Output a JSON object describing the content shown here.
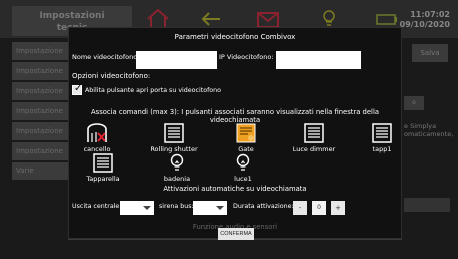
{
  "background": {
    "title_line1": "Impostazioni",
    "title_line2": "tecnic",
    "time": "11:07:02",
    "date": "09/10/2020",
    "save_label": "Salva",
    "sidebar": [
      "Impostazione",
      "Impostazione",
      "Impostazione",
      "Impostazione",
      "Impostazione",
      "Impostazione",
      "Varie"
    ],
    "side_text_1": "e Simplya",
    "side_text_2": "omaticamente,",
    "side_box": "o"
  },
  "dialog": {
    "title": "Parametri videocitofono Combivox",
    "name_label": "Nome videocitofono:",
    "name_value": "",
    "ip_label": "IP Videocitofono:",
    "ip_value": "",
    "options_label": "Opzioni videocitofono:",
    "door_checkbox_label": "Abilita pulsante apri porta su videocitofono",
    "door_checked": true,
    "associate_header": "Associa comandi (max 3): I pulsanti associati saranno visualizzati nella finestra della videochiamata",
    "commands": [
      {
        "label": "cancello",
        "icon": "gate-crossed-icon"
      },
      {
        "label": "Rolling shutter",
        "icon": "shutter-icon"
      },
      {
        "label": "Gate",
        "icon": "gate-orange-icon"
      },
      {
        "label": "Luce dimmer",
        "icon": "shutter-icon"
      },
      {
        "label": "tapp1",
        "icon": "shutter-icon"
      },
      {
        "label": "Tapparella",
        "icon": "shutter-icon"
      },
      {
        "label": "badenia",
        "icon": "bulb-icon"
      },
      {
        "label": "luce1",
        "icon": "bulb-icon"
      }
    ],
    "auto_header": "Attivazioni automatiche su videochiamata",
    "output_label": "Uscita centrale:",
    "siren_label": "sirena bus:",
    "duration_label": "Durata attivazione:",
    "minus_label": "-",
    "duration_value": "0",
    "plus_label": "+",
    "faded_text": "Funzione audio e sensori",
    "confirm_label": "CONFERMA"
  },
  "colors": {
    "accent_red": "#c62f3b",
    "accent_yellow": "#c9c02a",
    "accent_orange": "#f0a020"
  }
}
